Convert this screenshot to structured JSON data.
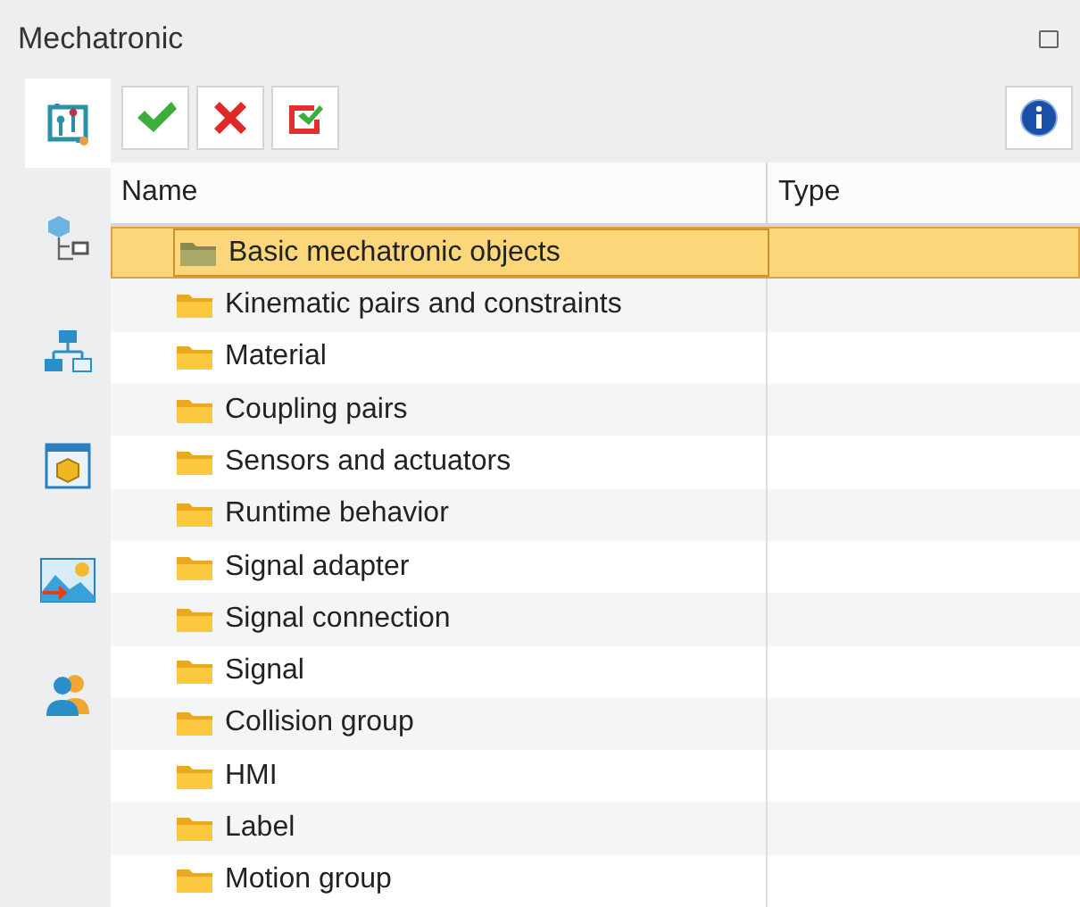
{
  "window": {
    "title": "Mechatronic"
  },
  "sidebar": {
    "tabs": [
      {
        "kind": "circuit",
        "selected": true
      },
      {
        "kind": "cube-tree",
        "selected": false
      },
      {
        "kind": "hierarchy",
        "selected": false
      },
      {
        "kind": "box-window",
        "selected": false
      },
      {
        "kind": "image-arrow",
        "selected": false
      },
      {
        "kind": "users",
        "selected": false
      }
    ]
  },
  "toolbar": {
    "buttons": [
      {
        "kind": "accept"
      },
      {
        "kind": "cancel"
      },
      {
        "kind": "check-box"
      }
    ],
    "right_buttons": [
      {
        "kind": "info"
      }
    ]
  },
  "table": {
    "columns": [
      "Name",
      "Type"
    ],
    "rows": [
      {
        "name": "Basic mechatronic objects",
        "selected": true
      },
      {
        "name": "Kinematic pairs and constraints",
        "selected": false
      },
      {
        "name": "Material",
        "selected": false
      },
      {
        "name": "Coupling pairs",
        "selected": false
      },
      {
        "name": "Sensors and actuators",
        "selected": false
      },
      {
        "name": "Runtime behavior",
        "selected": false
      },
      {
        "name": "Signal adapter",
        "selected": false
      },
      {
        "name": "Signal connection",
        "selected": false
      },
      {
        "name": "Signal",
        "selected": false
      },
      {
        "name": "Collision group",
        "selected": false
      },
      {
        "name": "HMI",
        "selected": false
      },
      {
        "name": "Label",
        "selected": false
      },
      {
        "name": "Motion group",
        "selected": false
      }
    ]
  }
}
